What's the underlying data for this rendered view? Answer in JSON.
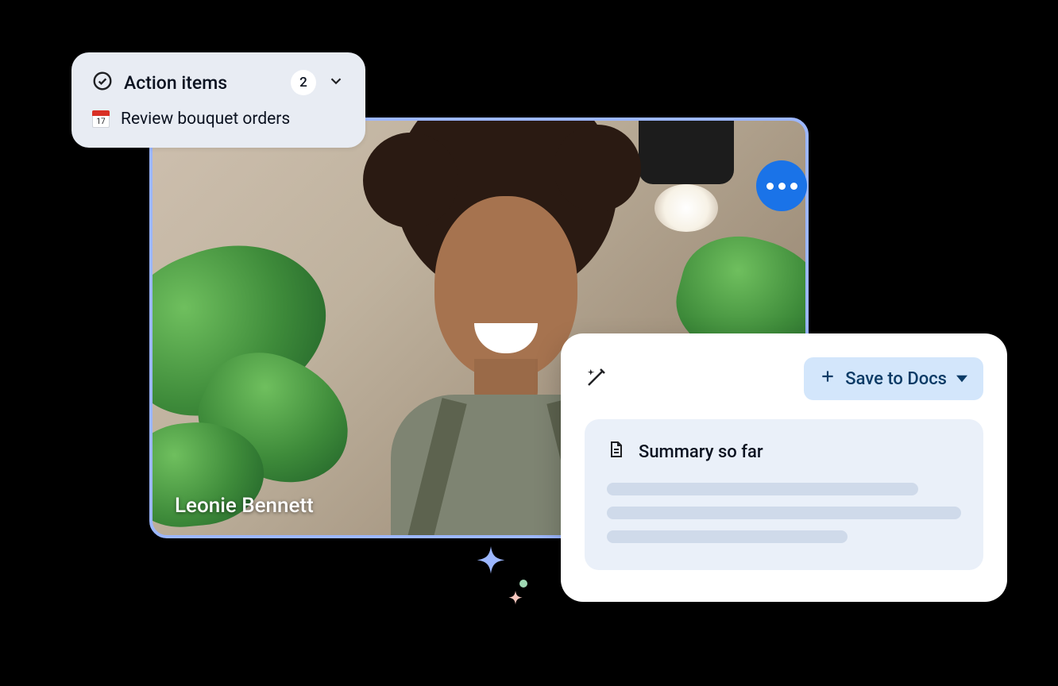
{
  "video": {
    "participant_name": "Leonie Bennett"
  },
  "action_items": {
    "title": "Action items",
    "count": "2",
    "items": [
      {
        "icon_day": "17",
        "label": "Review bouquet orders"
      }
    ]
  },
  "summary_panel": {
    "save_button_label": "Save to Docs",
    "section_title": "Summary so far"
  }
}
